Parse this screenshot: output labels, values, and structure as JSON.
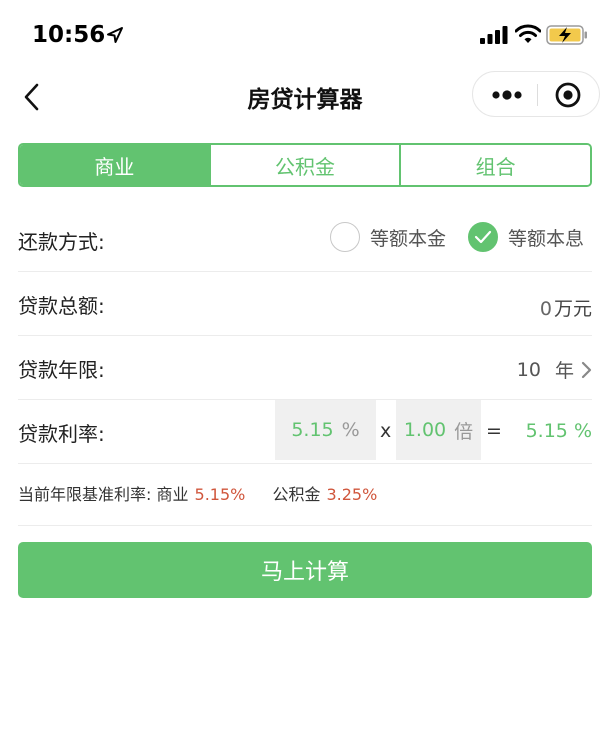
{
  "status_bar": {
    "time": "10:56",
    "icons": [
      "location-arrow-icon",
      "signal-icon",
      "wifi-icon",
      "battery-charging-icon"
    ]
  },
  "nav": {
    "title": "房贷计算器",
    "icons": [
      "back-icon",
      "more-icon",
      "target-icon"
    ]
  },
  "tabs": [
    {
      "label": "商业",
      "active": true
    },
    {
      "label": "公积金",
      "active": false
    },
    {
      "label": "组合",
      "active": false
    }
  ],
  "repayment": {
    "label": "还款方式:",
    "options": [
      {
        "label": "等额本金",
        "checked": false
      },
      {
        "label": "等额本息",
        "checked": true
      }
    ]
  },
  "loan_amount": {
    "label": "贷款总额:",
    "value": "0",
    "unit": "万元"
  },
  "loan_term": {
    "label": "贷款年限:",
    "value": "10",
    "unit": "年"
  },
  "interest_rate": {
    "label": "贷款利率:",
    "base": "5.15",
    "base_unit": "%",
    "multiply_sign": "x",
    "multiplier": "1.00",
    "multiplier_unit": "倍",
    "equals_sign": "=",
    "result": "5.15 %"
  },
  "benchmark": {
    "label": "当前年限基准利率:",
    "commercial_label": "商业",
    "commercial_value": "5.15%",
    "fund_label": "公积金",
    "fund_value": "3.25%"
  },
  "calc_button": {
    "label": "马上计算"
  },
  "colors": {
    "accent": "#62c370",
    "rate_highlight": "#d0563c"
  }
}
